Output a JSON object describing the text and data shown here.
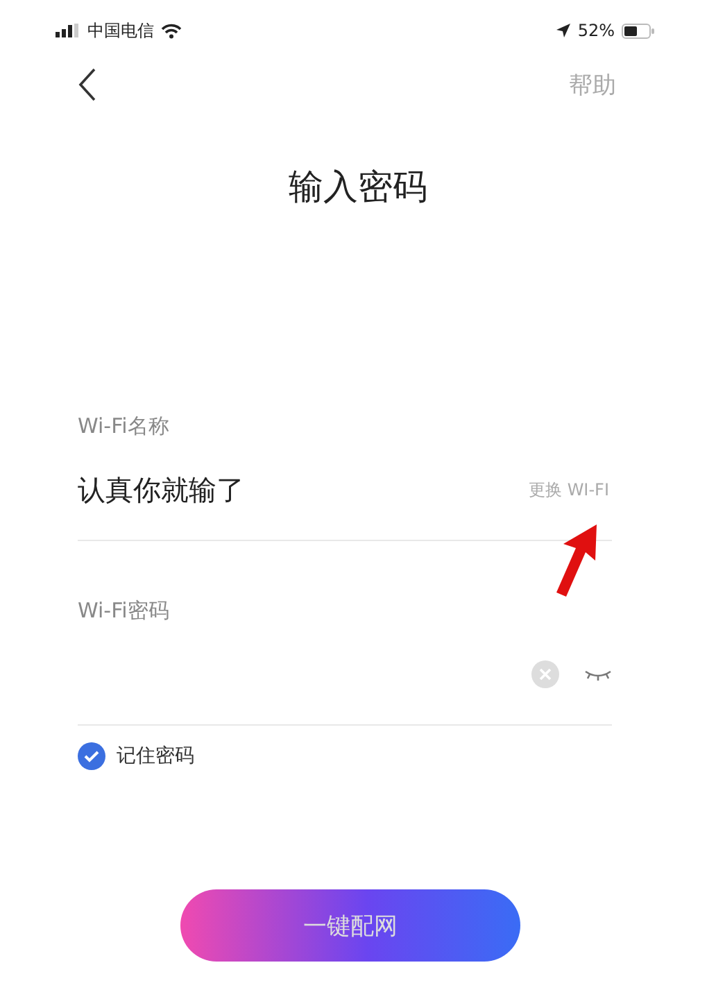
{
  "status_bar": {
    "carrier": "中国电信",
    "battery": "52%"
  },
  "nav": {
    "help": "帮助"
  },
  "title": "输入密码",
  "wifi_name": {
    "label": "Wi-Fi名称",
    "value": "认真你就输了",
    "change": "更换 WI-FI"
  },
  "wifi_password": {
    "label": "Wi-Fi密码"
  },
  "remember": {
    "label": "记住密码",
    "checked": true
  },
  "submit": "一键配网"
}
